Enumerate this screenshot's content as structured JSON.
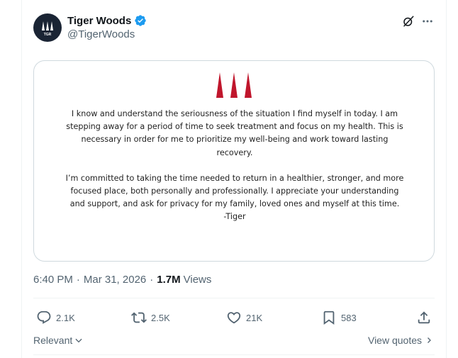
{
  "author": {
    "display_name": "Tiger Woods",
    "handle": "@TigerWoods",
    "verified": true,
    "avatar_text": "TGR"
  },
  "statement": {
    "paragraph1": "I know and understand the seriousness of the situation I find myself in today. I am stepping away for a period of time to seek treatment and focus on my health. This is necessary in order for me to prioritize my well-being and work toward lasting recovery.",
    "paragraph2": "I’m committed to taking the time needed to return in a healthier, stronger, and more focused place, both personally and professionally. I appreciate your understanding and support, and ask for privacy for my family, loved ones and myself at this time.",
    "signature": "-Tiger",
    "logo_color": "#c0162c"
  },
  "meta": {
    "time": "6:40 PM",
    "separator": "·",
    "date": "Mar 31, 2026",
    "views_count": "1.7M",
    "views_label": "Views"
  },
  "actions": {
    "replies": "2.1K",
    "reposts": "2.5K",
    "likes": "21K",
    "bookmarks": "583"
  },
  "footer": {
    "sort_label": "Relevant",
    "quotes_label": "View quotes"
  },
  "colors": {
    "text_primary": "#0f1419",
    "text_secondary": "#536471",
    "verified_blue": "#1d9bf0",
    "border": "#cfd9de"
  }
}
